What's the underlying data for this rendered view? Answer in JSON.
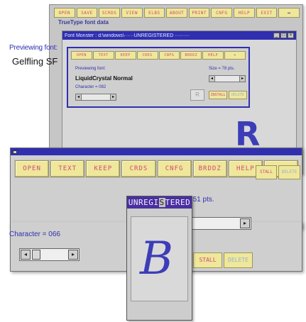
{
  "back_window": {
    "toolbar": [
      "OPEN",
      "SAVE",
      "SCRDS",
      "VIEW",
      "ELBS",
      "ABOUT",
      "PRINT",
      "CNFG",
      "HELP",
      "EXIT",
      "⬌"
    ],
    "heading": "TrueType font data",
    "font_monster": {
      "title": "Font Monster : d:\\windows\\······UNREGISTERED ·········",
      "toolbar": [
        "OPEN",
        "TEXT",
        "KEEP",
        "CRDS",
        "CNFG",
        "BRDDZ",
        "HELP",
        "⬌"
      ],
      "previewing_label": "Previewing font:",
      "font_name": "LiquidCrystal Normal",
      "character_label": "Character = 082",
      "char_box": "R",
      "size_label": "Size = 78 pts.",
      "buttons": [
        "INSTALL",
        "DELETE"
      ],
      "preview_glyph": "R"
    }
  },
  "front_window": {
    "toolbar": [
      "OPEN",
      "TEXT",
      "KEEP",
      "CRDS",
      "CNFG",
      "BRDDZ",
      "HELP",
      "⬌"
    ],
    "previewing_label": "Previewing font:",
    "font_name": "Gelfling SF",
    "character_label": "Character = 066",
    "size_label": "= 51 pts.",
    "buttons": [
      "STALL",
      "DELETE"
    ],
    "side_buttons": [
      "STALL",
      "DELETE"
    ]
  },
  "popup": {
    "title_prefix": "UNREGI",
    "title_box": "S",
    "title_suffix": "TERED",
    "preview_glyph": "B"
  },
  "colors": {
    "title_bar": "#2f2fb0",
    "toolbar_button": "#efe79a",
    "toolbar_text": "#d04a7a",
    "label_text": "#2f2fb0",
    "glyph": "#3d3db8"
  }
}
